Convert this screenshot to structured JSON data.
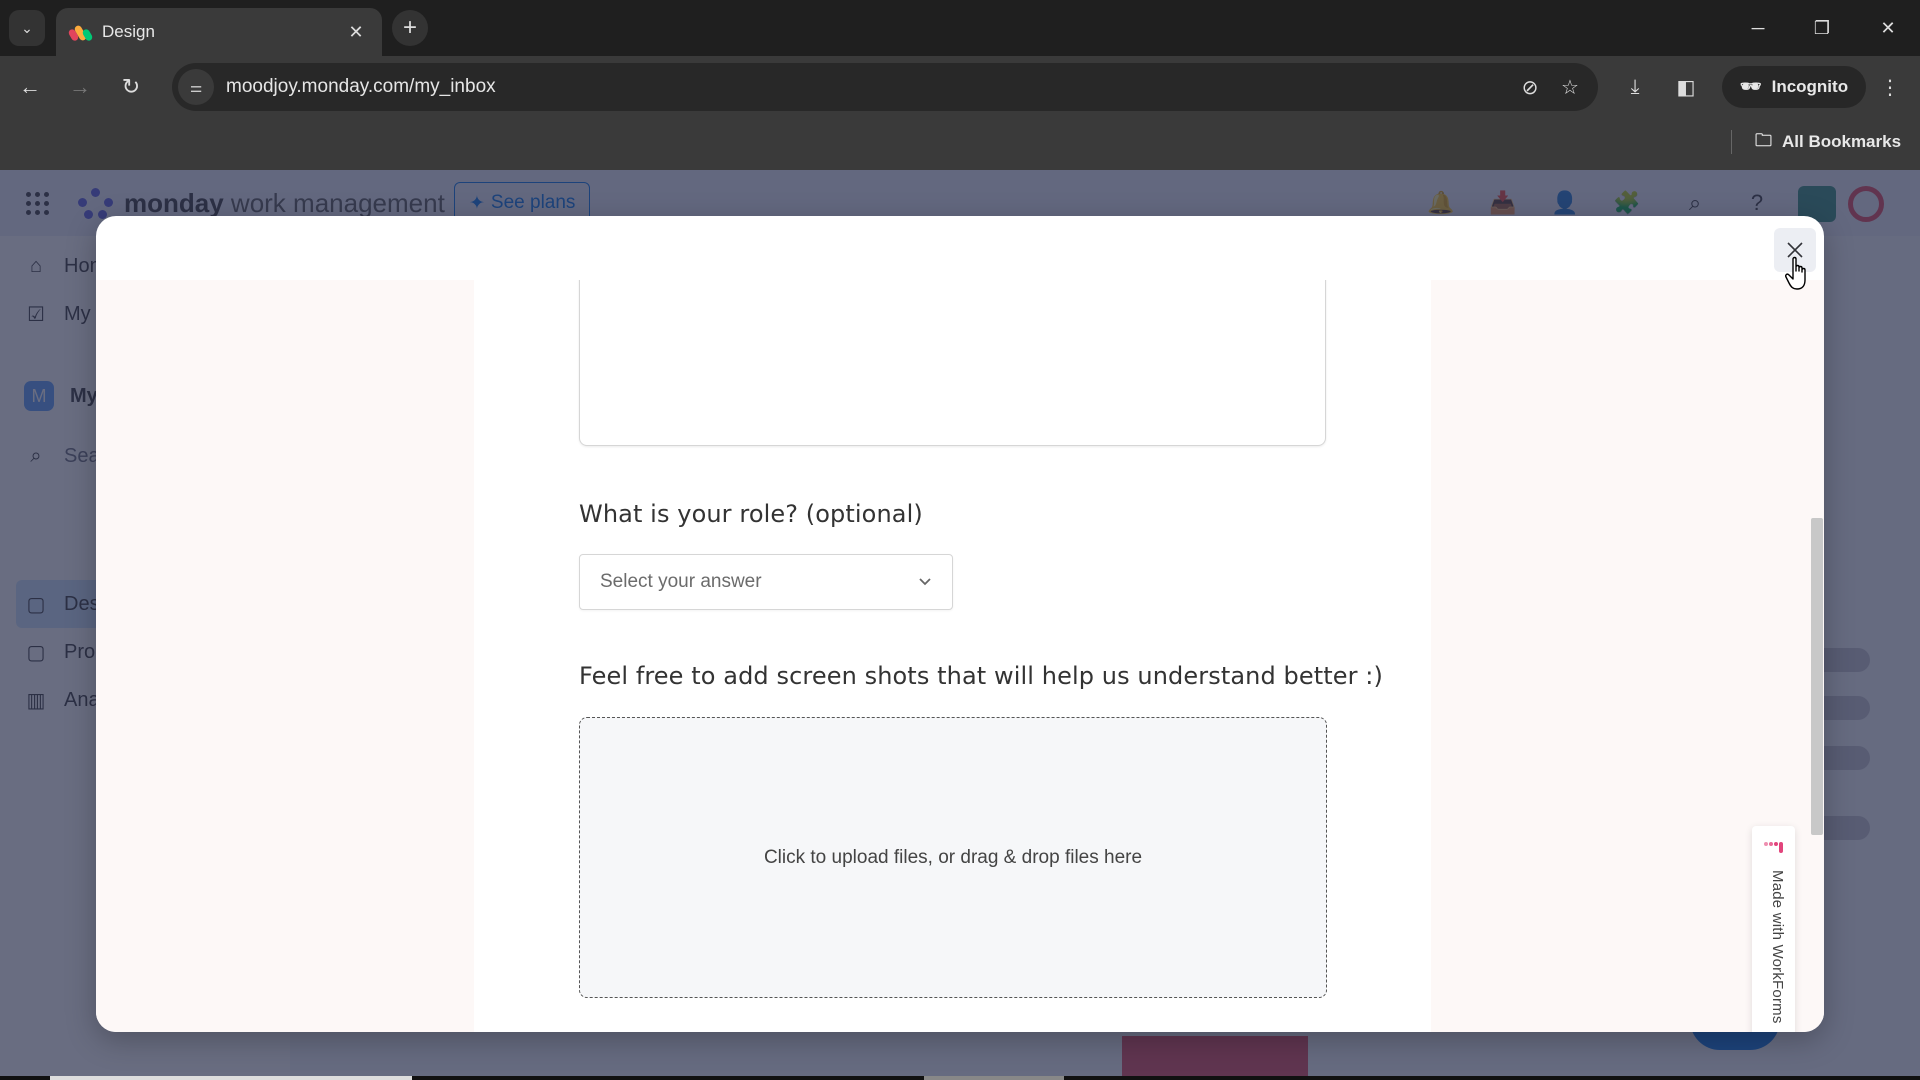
{
  "browser": {
    "tab": {
      "title": "Design",
      "favicon": "monday-favicon"
    },
    "url": "moodjoy.monday.com/my_inbox",
    "incognito_label": "Incognito",
    "bookmarks_label": "All Bookmarks",
    "icons": {
      "tab_list": "chevron-down-icon",
      "new_tab": "plus-icon",
      "back": "arrow-left-icon",
      "forward": "arrow-right-icon",
      "reload": "reload-icon",
      "site_info": "tune-icon",
      "tracking": "eye-off-icon",
      "bookmark": "star-icon",
      "download": "download-icon",
      "side_panel": "side-panel-icon",
      "menu": "kebab-menu-icon"
    },
    "glyphs": {
      "tab_list": "⌄",
      "tab_close": "✕",
      "new_tab": "+",
      "minimize": "─",
      "restore": "❐",
      "close": "✕",
      "back": "←",
      "forward": "→",
      "reload": "↻",
      "site_info": "⚌",
      "eye_off": "⊘",
      "star": "☆",
      "download": "⤓",
      "side_panel": "◧",
      "menu": "⋮",
      "incognito": "🕶",
      "folder": "🗀"
    }
  },
  "app": {
    "brand_bold": "monday",
    "brand_light": " work management",
    "see_plans_label": "See plans",
    "header_glyphs": {
      "notifications": "🔔",
      "inbox": "📥",
      "invite": "👤",
      "apps": "🧩",
      "search": "⌕",
      "help": "?"
    },
    "sidebar": {
      "items": [
        {
          "label": "Home",
          "glyph": "⌂"
        },
        {
          "label": "My work",
          "glyph": "☑"
        }
      ],
      "workspace": {
        "initial": "M",
        "label": "My workspace"
      },
      "search_label": "Search",
      "boards": [
        {
          "label": "Design",
          "glyph": "▢",
          "active": true
        },
        {
          "label": "Product",
          "glyph": "▢",
          "active": false
        },
        {
          "label": "Analytics",
          "glyph": "▥",
          "active": false
        }
      ]
    }
  },
  "modal": {
    "close_glyph": "✕",
    "role_question": "What is your role? (optional)",
    "role_select_placeholder": "Select your answer",
    "select_chevron": "⌄",
    "screenshots_question": "Feel free to add screen shots that will help us understand better :)",
    "dropzone_text": "Click to upload files, or drag & drop files here",
    "badge_text": "Made with WorkForms",
    "colors": {
      "side_panel": "#fdf8f7",
      "badge_accent": "#e2447c"
    }
  }
}
